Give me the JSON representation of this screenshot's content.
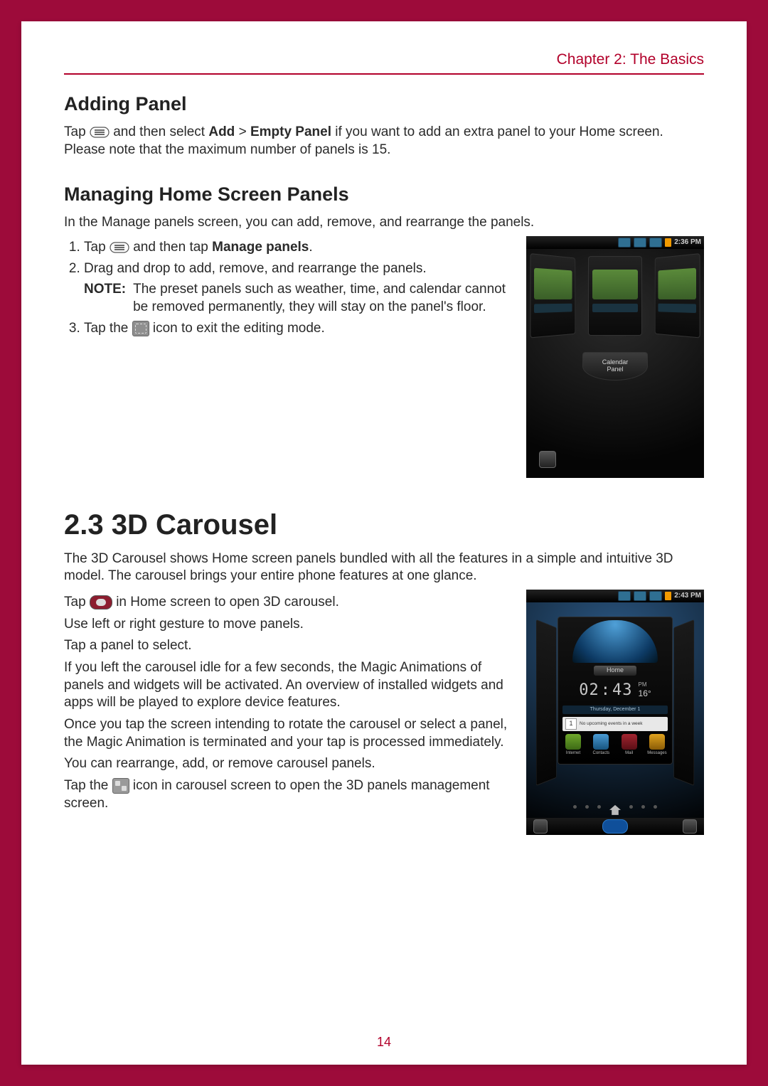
{
  "header": {
    "chapter": "Chapter 2: The Basics"
  },
  "adding_panel": {
    "heading": "Adding Panel",
    "tap": "Tap ",
    "mid1": " and then select ",
    "add": "Add",
    "gt": " > ",
    "empty_panel": "Empty Panel",
    "rest": " if you want to add an extra panel to your Home screen. Please note that the maximum number of panels is 15."
  },
  "managing": {
    "heading": "Managing Home Screen Panels",
    "intro": "In the Manage panels screen, you can add, remove, and rearrange the panels.",
    "s1a": "Tap ",
    "s1b": " and then tap ",
    "s1_bold": "Manage panels",
    "s1c": ".",
    "s2": "Drag and drop to add, remove, and rearrange the panels.",
    "note_label": "NOTE:",
    "note_text": "The preset panels such as weather, time, and calendar cannot be removed permanently, they will stay on the panel's floor.",
    "s3a": "Tap the ",
    "s3b": "  icon to exit the editing mode."
  },
  "phone1": {
    "time": "2:36 PM",
    "floor_label": "Calendar\nPanel"
  },
  "carousel": {
    "heading": "2.3 3D Carousel",
    "intro": "The 3D Carousel shows Home screen panels bundled with all the features in a simple and intuitive 3D model. The carousel brings your entire phone features at one glance.",
    "p1a": "Tap ",
    "p1b": "  in Home screen to open 3D carousel.",
    "p2": "Use left or right gesture to move panels.",
    "p3": "Tap a panel to select.",
    "p4": "If you left the carousel idle for a few seconds, the Magic Animations of panels and widgets will be activated. An overview of installed widgets and apps will be played to explore device features.",
    "p5": "Once you tap the screen intending to rotate the carousel or select a panel, the Magic Animation is terminated and your tap is processed immediately.",
    "p6": "You can rearrange, add, or remove carousel panels.",
    "p7a": "Tap the ",
    "p7b": "  icon in carousel screen to open the 3D panels management screen."
  },
  "phone2": {
    "time": "2:43 PM",
    "home_label": "Home",
    "clock_hh": "02",
    "clock_mm": "43",
    "clock_ampm": "PM",
    "temp": "16°",
    "date_line": "Thursday, December 1",
    "event_day": "1",
    "event_text": "No upcoming events in a week",
    "apps": [
      "Internet",
      "Contacts",
      "Mail",
      "Messages"
    ]
  },
  "page_number": "14"
}
